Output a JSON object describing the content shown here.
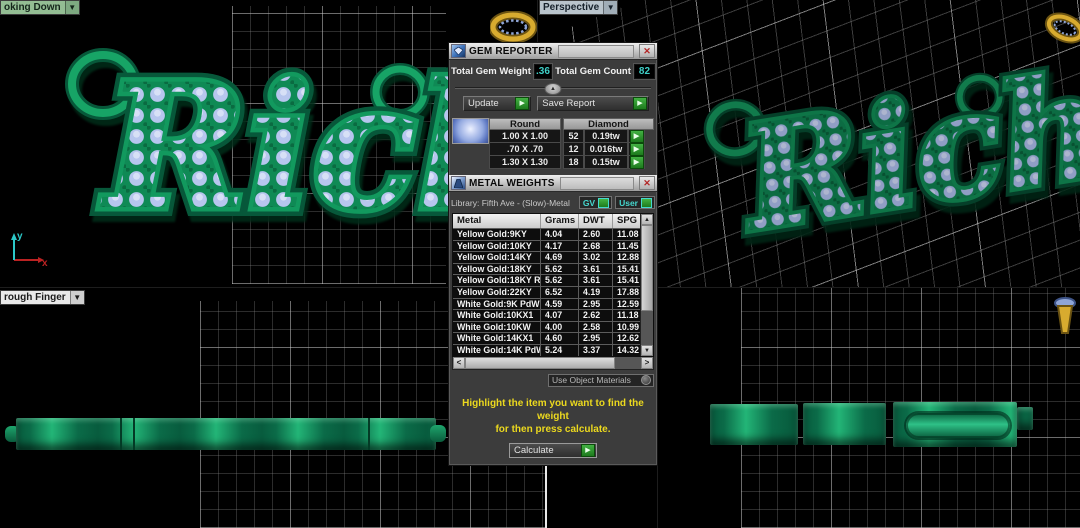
{
  "icons": {
    "dropdown_arrow": "▼",
    "play_arrow": "▶",
    "collapse_arrow": "▲",
    "scroll_up": "▲",
    "scroll_down": "▼",
    "scroll_left": "<",
    "scroll_right": ">",
    "close": "✕"
  },
  "axis": {
    "x": "x",
    "y": "y"
  },
  "pendant": {
    "text": "Rich"
  },
  "viewports": {
    "top_left": {
      "label": "oking Down"
    },
    "top_right": {
      "label": "Perspective"
    },
    "bottom_left": {
      "label": "rough Finger"
    }
  },
  "gem_reporter": {
    "title": "GEM REPORTER",
    "weight_label": "Total Gem Weight",
    "weight_value": ".36",
    "count_label": "Total Gem Count",
    "count_value": "82",
    "update_label": "Update",
    "save_report_label": "Save Report",
    "col_round": "Round",
    "col_diamond": "Diamond",
    "rows": [
      {
        "size": "1.00 X 1.00",
        "count": "52",
        "tw": "0.19tw"
      },
      {
        "size": ".70 X .70",
        "count": "12",
        "tw": "0.016tw"
      },
      {
        "size": "1.30 X 1.30",
        "count": "18",
        "tw": "0.15tw"
      }
    ]
  },
  "metal_weights": {
    "title": "METAL WEIGHTS",
    "library": "Library: Fifth Ave - (Slow)-Metal",
    "gv_label": "GV",
    "user_label": "User",
    "columns": [
      "Metal",
      "Grams",
      "DWT",
      "SPG"
    ],
    "rows": [
      {
        "metal": "Yellow Gold:9KY",
        "grams": "4.04",
        "dwt": "2.60",
        "spg": "11.08"
      },
      {
        "metal": "Yellow Gold:10KY",
        "grams": "4.17",
        "dwt": "2.68",
        "spg": "11.45"
      },
      {
        "metal": "Yellow Gold:14KY",
        "grams": "4.69",
        "dwt": "3.02",
        "spg": "12.88"
      },
      {
        "metal": "Yellow Gold:18KY",
        "grams": "5.62",
        "dwt": "3.61",
        "spg": "15.41"
      },
      {
        "metal": "Yellow Gold:18KY R...",
        "grams": "5.62",
        "dwt": "3.61",
        "spg": "15.41"
      },
      {
        "metal": "Yellow Gold:22KY",
        "grams": "6.52",
        "dwt": "4.19",
        "spg": "17.88"
      },
      {
        "metal": "White Gold:9K PdW",
        "grams": "4.59",
        "dwt": "2.95",
        "spg": "12.59"
      },
      {
        "metal": "White Gold:10KX1",
        "grams": "4.07",
        "dwt": "2.62",
        "spg": "11.18"
      },
      {
        "metal": "White Gold:10KW",
        "grams": "4.00",
        "dwt": "2.58",
        "spg": "10.99"
      },
      {
        "metal": "White Gold:14KX1",
        "grams": "4.60",
        "dwt": "2.95",
        "spg": "12.62"
      },
      {
        "metal": "White Gold:14K PdW",
        "grams": "5.24",
        "dwt": "3.37",
        "spg": "14.32"
      }
    ],
    "use_object_materials": "Use Object Materials",
    "instruction_line1": "Highlight the item you want to find the weight",
    "instruction_line2": "for then press calculate.",
    "calculate_label": "Calculate"
  },
  "colors": {
    "pendant_green": "#0f8a55",
    "gem_blue": "#b7c6ee",
    "accent_green": "#2f9e2f",
    "value_teal": "#3fd0c8",
    "instruction_yellow": "#ecd91e",
    "close_red": "#b22525",
    "gold": "#caa32e",
    "axis_red": "#bb2222",
    "axis_cyan": "#2cc8c8"
  }
}
